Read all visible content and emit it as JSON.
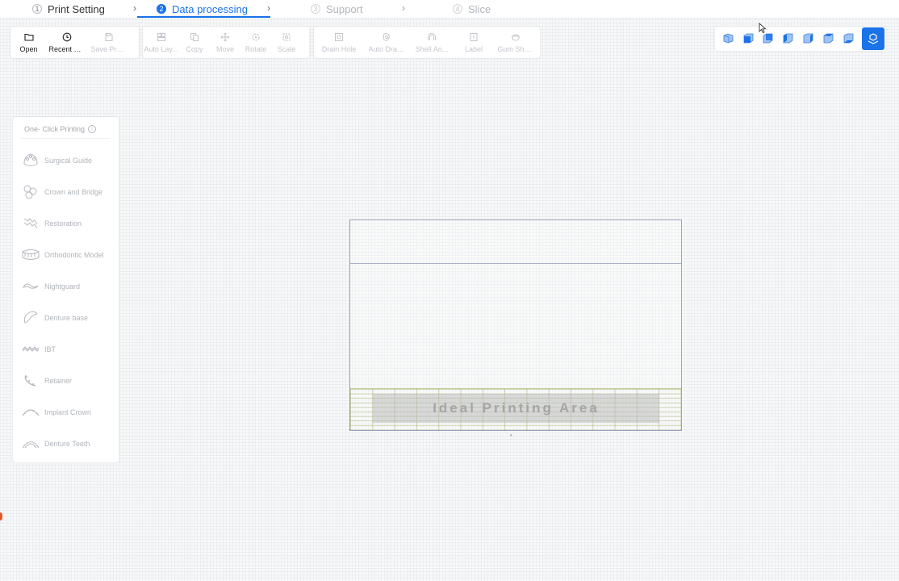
{
  "steps": [
    {
      "num": "1",
      "label": "Print Setting"
    },
    {
      "num": "2",
      "label": "Data processing"
    },
    {
      "num": "3",
      "label": "Support"
    },
    {
      "num": "4",
      "label": "Slice"
    }
  ],
  "toolbar": {
    "file": [
      {
        "label": "Open",
        "icon": "folder-icon"
      },
      {
        "label": "Recent File",
        "icon": "clock-icon"
      },
      {
        "label": "Save Proj...",
        "icon": "save-icon"
      }
    ],
    "edit": [
      {
        "label": "Auto Lay...",
        "icon": "layout-icon"
      },
      {
        "label": "Copy",
        "icon": "copy-icon"
      },
      {
        "label": "Move",
        "icon": "move-icon"
      },
      {
        "label": "Rotate",
        "icon": "rotate-icon"
      },
      {
        "label": "Scale",
        "icon": "scale-icon"
      }
    ],
    "process": [
      {
        "label": "Drain Hole",
        "icon": "drain-hole-icon"
      },
      {
        "label": "Auto Drai...",
        "icon": "auto-drain-icon"
      },
      {
        "label": "Shell An...",
        "icon": "shell-icon"
      },
      {
        "label": "Label",
        "icon": "label-icon"
      },
      {
        "label": "Gum She...",
        "icon": "gum-shell-icon"
      }
    ]
  },
  "views": [
    "iso-view-icon",
    "front-view-icon",
    "back-view-icon",
    "left-view-icon",
    "right-view-icon",
    "top-view-icon",
    "bottom-view-icon",
    "place-on-plate-icon"
  ],
  "panel": {
    "title": "One- Click Printing",
    "items": [
      {
        "label": "Surgical Guide"
      },
      {
        "label": "Crown and Bridge"
      },
      {
        "label": "Restoration"
      },
      {
        "label": "Orthodontic Model"
      },
      {
        "label": "Nightguard"
      },
      {
        "label": "Denture base"
      },
      {
        "label": "IBT"
      },
      {
        "label": "Retainer"
      },
      {
        "label": "Implant Crown"
      },
      {
        "label": "Denture Teeth"
      }
    ]
  },
  "plate": {
    "ideal_label": "Ideal Printing Area"
  },
  "colors": {
    "accent": "#1a73e8"
  }
}
